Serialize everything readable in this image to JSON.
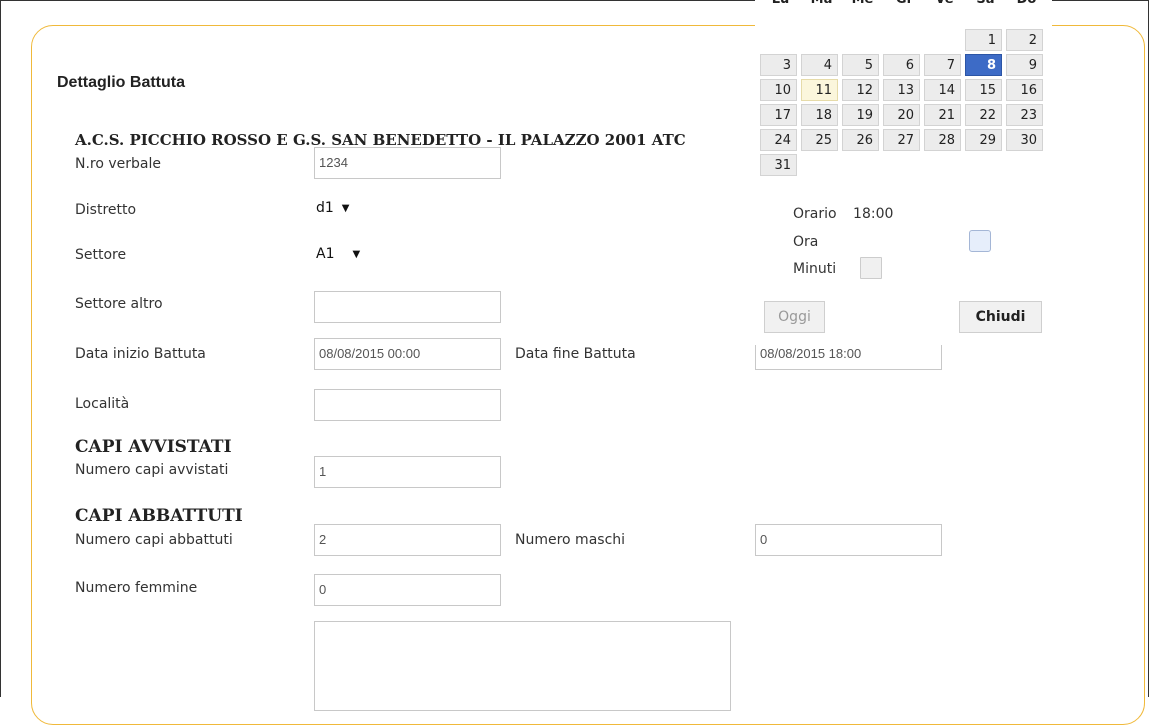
{
  "page": {
    "title": "Dettaglio Battuta",
    "club": "A.C.S. PICCHIO ROSSO E G.S. SAN BENEDETTO - IL PALAZZO 2001  ATC"
  },
  "form": {
    "verbale": {
      "label": "N.ro verbale",
      "value": "1234"
    },
    "distretto": {
      "label": "Distretto",
      "value": "d1"
    },
    "settore": {
      "label": "Settore",
      "value": "A1"
    },
    "settore_altro": {
      "label": "Settore altro",
      "value": ""
    },
    "data_inizio": {
      "label": "Data inizio Battuta",
      "value": "08/08/2015 00:00"
    },
    "data_fine": {
      "label": "Data fine Battuta",
      "value": "08/08/2015 18:00"
    },
    "localita": {
      "label": "Località",
      "value": ""
    },
    "capi_avvistati_title": "CAPI AVVISTATI",
    "numero_capi_avvistati": {
      "label": "Numero capi avvistati",
      "value": "1"
    },
    "capi_abbattuti_title": "CAPI ABBATTUTI",
    "numero_capi_abbattuti": {
      "label": "Numero capi abbattuti",
      "value": "2"
    },
    "numero_maschi": {
      "label": "Numero maschi",
      "value": "0"
    },
    "numero_femmine": {
      "label": "Numero femmine",
      "value": "0"
    }
  },
  "calendar": {
    "weekdays": [
      "Lu",
      "Ma",
      "Me",
      "Gi",
      "Ve",
      "Sa",
      "Do"
    ],
    "first_weekday_index": 5,
    "days_in_month": 31,
    "today": 11,
    "selected": 8,
    "time_label": "Orario",
    "time_value": "18:00",
    "hour_label": "Ora",
    "minute_label": "Minuti",
    "hour_fraction": 0.78,
    "minute_fraction": 0.0,
    "today_button": "Oggi",
    "close_button": "Chiudi",
    "selected_color": "#3d6bc6"
  }
}
